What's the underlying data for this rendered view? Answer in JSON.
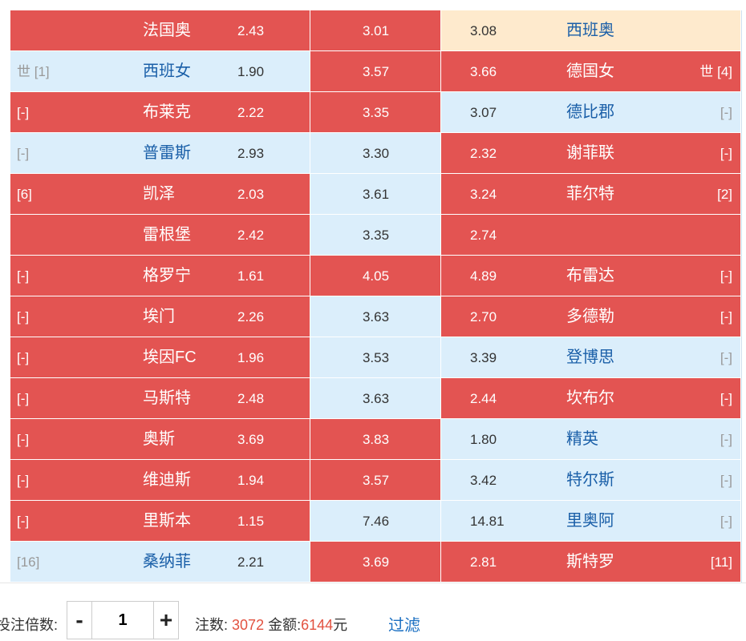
{
  "rows": [
    {
      "home_tag": "",
      "home": "法国奥",
      "home_odd": "2.43",
      "draw_odd": "3.01",
      "away_odd": "3.08",
      "away": "西班奥",
      "away_tag": "",
      "h": "red",
      "d": "red",
      "a": "beige"
    },
    {
      "home_tag": "世 [1]",
      "home": "西班女",
      "home_odd": "1.90",
      "draw_odd": "3.57",
      "away_odd": "3.66",
      "away": "德国女",
      "away_tag": "世 [4]",
      "h": "blue",
      "d": "red",
      "a": "red"
    },
    {
      "home_tag": "[-]",
      "home": "布莱克",
      "home_odd": "2.22",
      "draw_odd": "3.35",
      "away_odd": "3.07",
      "away": "德比郡",
      "away_tag": "[-]",
      "h": "red",
      "d": "red",
      "a": "blue"
    },
    {
      "home_tag": "[-]",
      "home": "普雷斯",
      "home_odd": "2.93",
      "draw_odd": "3.30",
      "away_odd": "2.32",
      "away": "谢菲联",
      "away_tag": "[-]",
      "h": "blue",
      "d": "blue",
      "a": "red"
    },
    {
      "home_tag": "[6]",
      "home": "凯泽",
      "home_odd": "2.03",
      "draw_odd": "3.61",
      "away_odd": "3.24",
      "away": "菲尔特",
      "away_tag": "[2]",
      "h": "red",
      "d": "blue",
      "a": "red"
    },
    {
      "home_tag": "",
      "home": "雷根堡",
      "home_odd": "2.42",
      "draw_odd": "3.35",
      "away_odd": "2.74",
      "away": "",
      "away_tag": "",
      "h": "red",
      "d": "blue",
      "a": "red"
    },
    {
      "home_tag": "[-]",
      "home": "格罗宁",
      "home_odd": "1.61",
      "draw_odd": "4.05",
      "away_odd": "4.89",
      "away": "布雷达",
      "away_tag": "[-]",
      "h": "red",
      "d": "red",
      "a": "red"
    },
    {
      "home_tag": "[-]",
      "home": "埃门",
      "home_odd": "2.26",
      "draw_odd": "3.63",
      "away_odd": "2.70",
      "away": "多德勒",
      "away_tag": "[-]",
      "h": "red",
      "d": "blue",
      "a": "red"
    },
    {
      "home_tag": "[-]",
      "home": "埃因FC",
      "home_odd": "1.96",
      "draw_odd": "3.53",
      "away_odd": "3.39",
      "away": "登博思",
      "away_tag": "[-]",
      "h": "red",
      "d": "blue",
      "a": "blue"
    },
    {
      "home_tag": "[-]",
      "home": "马斯特",
      "home_odd": "2.48",
      "draw_odd": "3.63",
      "away_odd": "2.44",
      "away": "坎布尔",
      "away_tag": "[-]",
      "h": "red",
      "d": "blue",
      "a": "red"
    },
    {
      "home_tag": "[-]",
      "home": "奥斯",
      "home_odd": "3.69",
      "draw_odd": "3.83",
      "away_odd": "1.80",
      "away": "精英",
      "away_tag": "[-]",
      "h": "red",
      "d": "red",
      "a": "blue"
    },
    {
      "home_tag": "[-]",
      "home": "维迪斯",
      "home_odd": "1.94",
      "draw_odd": "3.57",
      "away_odd": "3.42",
      "away": "特尔斯",
      "away_tag": "[-]",
      "h": "red",
      "d": "red",
      "a": "blue"
    },
    {
      "home_tag": "[-]",
      "home": "里斯本",
      "home_odd": "1.15",
      "draw_odd": "7.46",
      "away_odd": "14.81",
      "away": "里奥阿",
      "away_tag": "[-]",
      "h": "red",
      "d": "blue",
      "a": "blue"
    },
    {
      "home_tag": "[16]",
      "home": "桑纳菲",
      "home_odd": "2.21",
      "draw_odd": "3.69",
      "away_odd": "2.81",
      "away": "斯特罗",
      "away_tag": "[11]",
      "h": "blue",
      "d": "red",
      "a": "red"
    }
  ],
  "footer": {
    "multiplier_label": "投注倍数:",
    "minus": "-",
    "plus": "+",
    "multiplier_value": "1",
    "bets_label": "注数:",
    "bets_value": "3072",
    "amount_label": "金额:",
    "amount_value": "6144",
    "amount_unit": "元",
    "filter_label": "过滤"
  },
  "colors": {
    "selected_red": "#e35452",
    "unselected_blue": "#dbeefb",
    "highlight_beige": "#feeacd",
    "link_blue": "#1a6fc2"
  }
}
